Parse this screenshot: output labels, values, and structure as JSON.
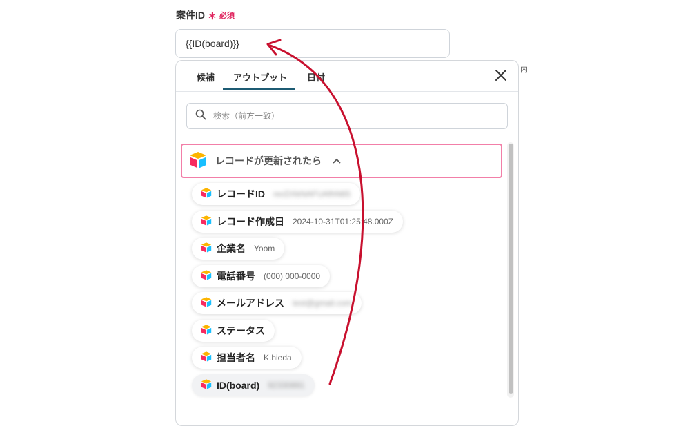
{
  "field": {
    "label": "案件ID",
    "required_mark": "＊",
    "required_text": "必須",
    "value": "{{ID(board)}}"
  },
  "side_clip": "内",
  "popup": {
    "tabs": [
      {
        "label": "候補"
      },
      {
        "label": "アウトプット"
      },
      {
        "label": "日付"
      }
    ],
    "active_tab": "アウトプット",
    "search_placeholder": "検索（前方一致）",
    "section_title": "レコードが更新されたら",
    "items": [
      {
        "label": "レコードID",
        "value": "recDXkNAFUAfhN65",
        "masked": true
      },
      {
        "label": "レコード作成日",
        "value": "2024-10-31T01:25:48.000Z",
        "masked": false
      },
      {
        "label": "企業名",
        "value": "Yoom",
        "masked": false
      },
      {
        "label": "電話番号",
        "value": "(000) 000-0000",
        "masked": false
      },
      {
        "label": "メールアドレス",
        "value": "test@gmail.com",
        "masked": true
      },
      {
        "label": "ステータス",
        "value": "",
        "masked": false
      },
      {
        "label": "担当者名",
        "value": "K.hieda",
        "masked": false
      },
      {
        "label": "ID(board)",
        "value": "92330891",
        "masked": true
      }
    ]
  },
  "colors": {
    "accent": "#1d5b73",
    "required": "#e0245e",
    "section_border": "#f27fa8",
    "arrow": "#c8102e"
  },
  "icons": {
    "app": "airtable-icon",
    "search": "search-icon",
    "close": "close-icon",
    "collapse": "chevron-up-icon"
  }
}
